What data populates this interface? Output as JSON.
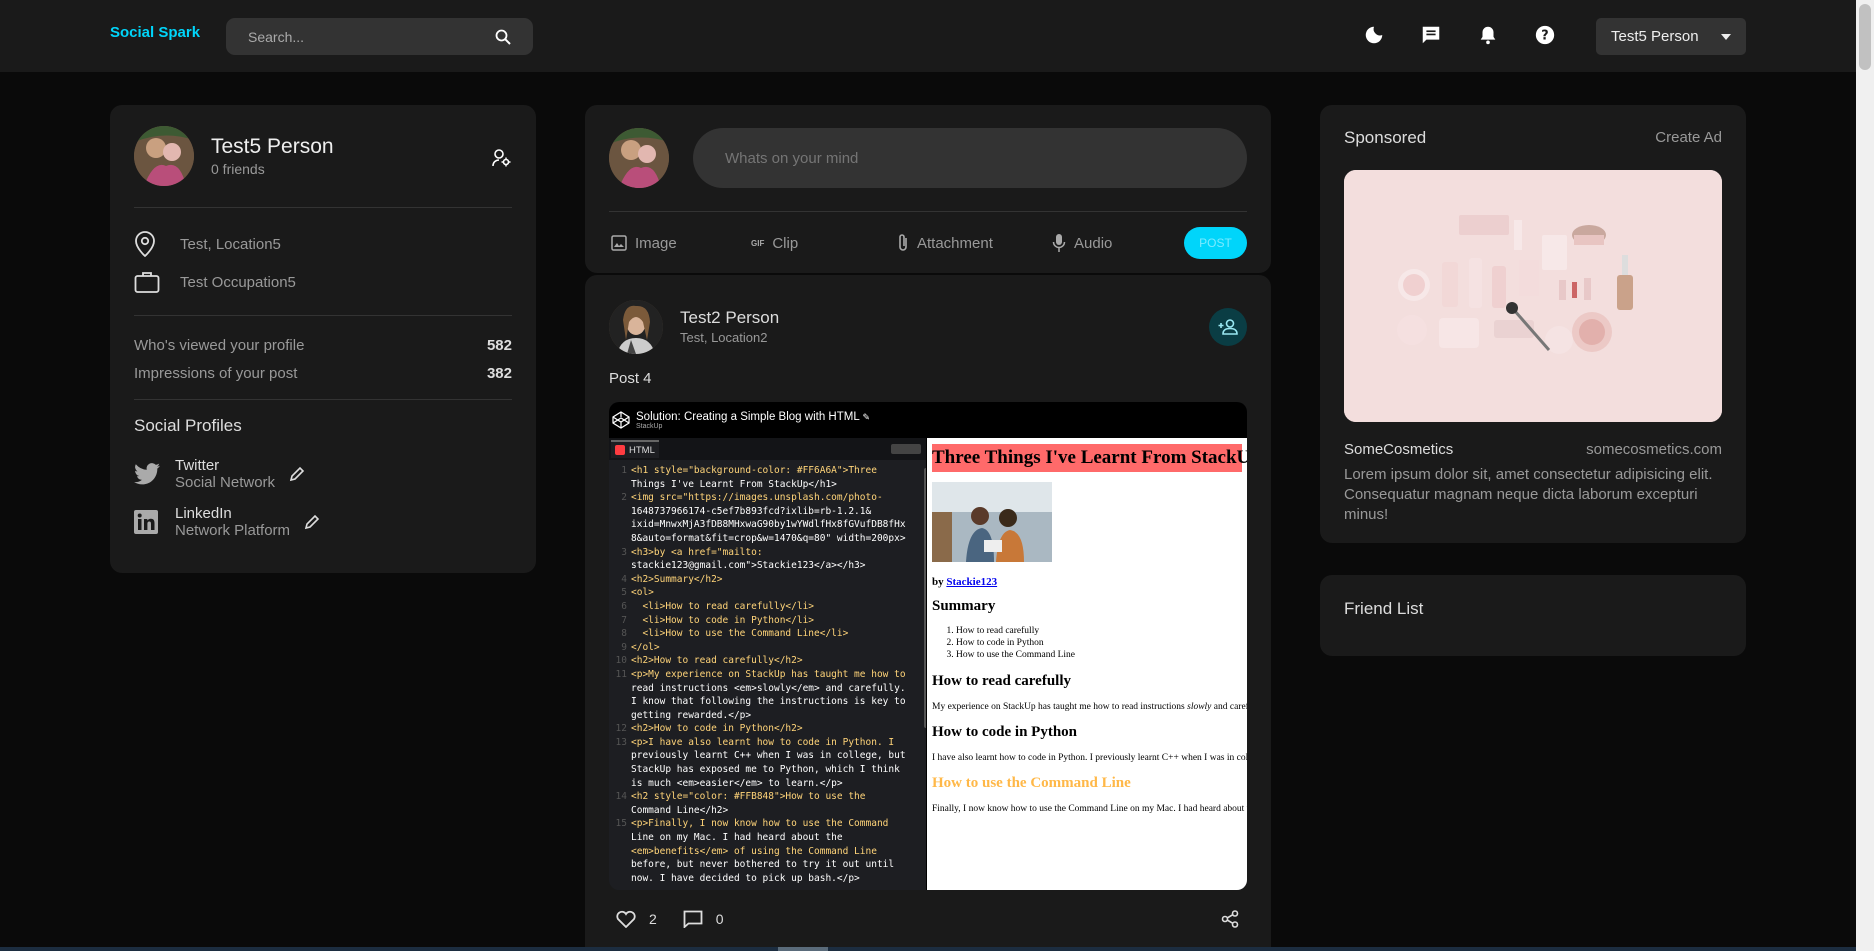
{
  "app": {
    "name": "Social Spark"
  },
  "search": {
    "placeholder": "Search..."
  },
  "header": {
    "user_name": "Test5 Person"
  },
  "profile": {
    "name": "Test5 Person",
    "friends": "0 friends",
    "location": "Test, Location5",
    "occupation": "Test Occupation5",
    "stats": [
      {
        "label": "Who's viewed your profile",
        "value": "582"
      },
      {
        "label": "Impressions of your post",
        "value": "382"
      }
    ],
    "social_title": "Social Profiles",
    "socials": [
      {
        "name": "Twitter",
        "sub": "Social Network"
      },
      {
        "name": "LinkedIn",
        "sub": "Network Platform"
      }
    ]
  },
  "composer": {
    "placeholder": "Whats on your mind",
    "actions": [
      "Image",
      "Clip",
      "Attachment",
      "Audio"
    ],
    "post_label": "POST",
    "gif_label": "GIF"
  },
  "post": {
    "author": "Test2 Person",
    "location": "Test, Location2",
    "text": "Post 4",
    "likes": "2",
    "comments": "0",
    "embed": {
      "title": "Solution: Creating a Simple Blog with HTML",
      "source": "StackUp",
      "tab": "HTML",
      "code_lines": [
        [
          "1",
          "<h1 style=\"background-color: #FF6A6A\">Three"
        ],
        [
          "",
          "Things I've Learnt From StackUp</h1>"
        ],
        [
          "2",
          "<img src=\"https://images.unsplash.com/photo-"
        ],
        [
          "",
          "1648737966174-c5ef7b893fcd?ixlib=rb-1.2.1&"
        ],
        [
          "",
          "ixid=MnwxMjA3fDB8MHxwaG90by1wYWdlfHx8fGVufDB8fHx"
        ],
        [
          "",
          "8&auto=format&fit=crop&w=1470&q=80\" width=200px>"
        ],
        [
          "3",
          "<h3>by <a href=\"mailto:"
        ],
        [
          "",
          "stackie123@gmail.com\">Stackie123</a></h3>"
        ],
        [
          "4",
          "<h2>Summary</h2>"
        ],
        [
          "5",
          "<ol>"
        ],
        [
          "6",
          "  <li>How to read carefully</li>"
        ],
        [
          "7",
          "  <li>How to code in Python</li>"
        ],
        [
          "8",
          "  <li>How to use the Command Line</li>"
        ],
        [
          "9",
          "</ol>"
        ],
        [
          "10",
          "<h2>How to read carefully</h2>"
        ],
        [
          "11",
          "<p>My experience on StackUp has taught me how to"
        ],
        [
          "",
          "read instructions <em>slowly</em> and carefully."
        ],
        [
          "",
          "I know that following the instructions is key to"
        ],
        [
          "",
          "getting rewarded.</p>"
        ],
        [
          "12",
          "<h2>How to code in Python</h2>"
        ],
        [
          "13",
          "<p>I have also learnt how to code in Python. I"
        ],
        [
          "",
          "previously learnt C++ when I was in college, but"
        ],
        [
          "",
          "StackUp has exposed me to Python, which I think"
        ],
        [
          "",
          "is much <em>easier</em> to learn.</p>"
        ],
        [
          "14",
          "<h2 style=\"color: #FFB848\">How to use the"
        ],
        [
          "",
          "Command Line</h2>"
        ],
        [
          "15",
          "<p>Finally, I now know how to use the Command"
        ],
        [
          "",
          "Line on my Mac. I had heard about the"
        ],
        [
          "",
          "<em>benefits</em> of using the Command Line"
        ],
        [
          "",
          "before, but never bothered to try it out until"
        ],
        [
          "",
          "now. I have decided to pick up bash.</p>"
        ]
      ],
      "preview": {
        "h1": "Three Things I've Learnt From StackUp",
        "by": "by",
        "by_link": "Stackie123",
        "summary": "Summary",
        "list": [
          "How to read carefully",
          "How to code in Python",
          "How to use the Command Line"
        ],
        "h_read": "How to read carefully",
        "p_read_a": "My experience on StackUp has taught me how to read instructions",
        "p_read_em": "slowly",
        "p_read_b": "and carefully.",
        "h_python": "How to code in Python",
        "p_python": "I have also learnt how to code in Python. I previously learnt C++ when I was in college, but",
        "h_cmd": "How to use the Command Line",
        "p_cmd": "Finally, I now know how to use the Command Line on my Mac. I had heard about the benefits"
      }
    }
  },
  "sponsored": {
    "title": "Sponsored",
    "create": "Create Ad",
    "brand": "SomeCosmetics",
    "url": "somecosmetics.com",
    "desc": "Lorem ipsum dolor sit, amet consectetur adipisicing elit. Consequatur magnam neque dicta laborum excepturi minus!"
  },
  "friend_list": {
    "title": "Friend List"
  },
  "colors": {
    "accent": "#00d5fa",
    "card": "#1a1a1a",
    "bg": "#0a0a0a"
  }
}
